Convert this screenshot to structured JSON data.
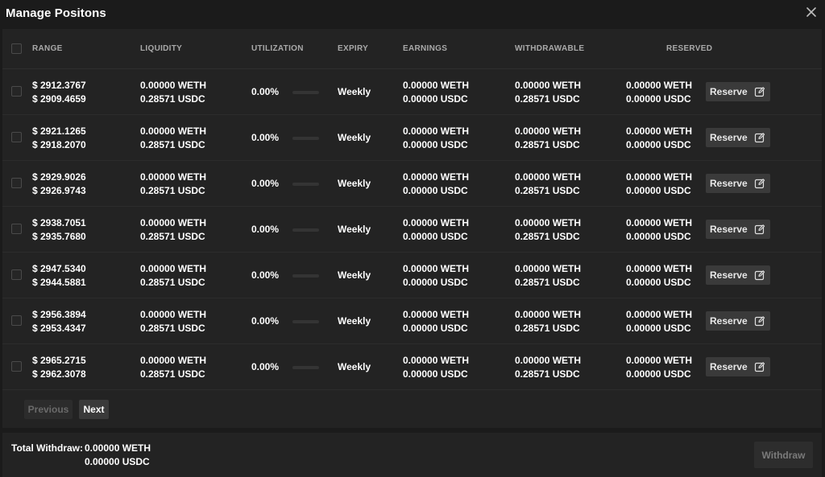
{
  "dialog": {
    "title": "Manage Positons",
    "close_icon": "close-icon"
  },
  "table": {
    "headers": {
      "range": "RANGE",
      "liquidity": "LIQUIDITY",
      "utilization": "UTILIZATION",
      "expiry": "EXPIRY",
      "earnings": "EARNINGS",
      "withdrawable": "WITHDRAWABLE",
      "reserved": "RESERVED"
    },
    "rows": [
      {
        "range_hi": "$ 2912.3767",
        "range_lo": "$ 2909.4659",
        "liq_weth": "0.00000 WETH",
        "liq_usdc": "0.28571 USDC",
        "utilization": "0.00%",
        "utilization_fraction": 0,
        "expiry": "Weekly",
        "earn_weth": "0.00000 WETH",
        "earn_usdc": "0.00000 USDC",
        "wd_weth": "0.00000 WETH",
        "wd_usdc": "0.28571 USDC",
        "res_weth": "0.00000 WETH",
        "res_usdc": "0.00000 USDC",
        "reserve_label": "Reserve"
      },
      {
        "range_hi": "$ 2921.1265",
        "range_lo": "$ 2918.2070",
        "liq_weth": "0.00000 WETH",
        "liq_usdc": "0.28571 USDC",
        "utilization": "0.00%",
        "utilization_fraction": 0,
        "expiry": "Weekly",
        "earn_weth": "0.00000 WETH",
        "earn_usdc": "0.00000 USDC",
        "wd_weth": "0.00000 WETH",
        "wd_usdc": "0.28571 USDC",
        "res_weth": "0.00000 WETH",
        "res_usdc": "0.00000 USDC",
        "reserve_label": "Reserve"
      },
      {
        "range_hi": "$ 2929.9026",
        "range_lo": "$ 2926.9743",
        "liq_weth": "0.00000 WETH",
        "liq_usdc": "0.28571 USDC",
        "utilization": "0.00%",
        "utilization_fraction": 0,
        "expiry": "Weekly",
        "earn_weth": "0.00000 WETH",
        "earn_usdc": "0.00000 USDC",
        "wd_weth": "0.00000 WETH",
        "wd_usdc": "0.28571 USDC",
        "res_weth": "0.00000 WETH",
        "res_usdc": "0.00000 USDC",
        "reserve_label": "Reserve"
      },
      {
        "range_hi": "$ 2938.7051",
        "range_lo": "$ 2935.7680",
        "liq_weth": "0.00000 WETH",
        "liq_usdc": "0.28571 USDC",
        "utilization": "0.00%",
        "utilization_fraction": 0,
        "expiry": "Weekly",
        "earn_weth": "0.00000 WETH",
        "earn_usdc": "0.00000 USDC",
        "wd_weth": "0.00000 WETH",
        "wd_usdc": "0.28571 USDC",
        "res_weth": "0.00000 WETH",
        "res_usdc": "0.00000 USDC",
        "reserve_label": "Reserve"
      },
      {
        "range_hi": "$ 2947.5340",
        "range_lo": "$ 2944.5881",
        "liq_weth": "0.00000 WETH",
        "liq_usdc": "0.28571 USDC",
        "utilization": "0.00%",
        "utilization_fraction": 0,
        "expiry": "Weekly",
        "earn_weth": "0.00000 WETH",
        "earn_usdc": "0.00000 USDC",
        "wd_weth": "0.00000 WETH",
        "wd_usdc": "0.28571 USDC",
        "res_weth": "0.00000 WETH",
        "res_usdc": "0.00000 USDC",
        "reserve_label": "Reserve"
      },
      {
        "range_hi": "$ 2956.3894",
        "range_lo": "$ 2953.4347",
        "liq_weth": "0.00000 WETH",
        "liq_usdc": "0.28571 USDC",
        "utilization": "0.00%",
        "utilization_fraction": 0,
        "expiry": "Weekly",
        "earn_weth": "0.00000 WETH",
        "earn_usdc": "0.00000 USDC",
        "wd_weth": "0.00000 WETH",
        "wd_usdc": "0.28571 USDC",
        "res_weth": "0.00000 WETH",
        "res_usdc": "0.00000 USDC",
        "reserve_label": "Reserve"
      },
      {
        "range_hi": "$ 2965.2715",
        "range_lo": "$ 2962.3078",
        "liq_weth": "0.00000 WETH",
        "liq_usdc": "0.28571 USDC",
        "utilization": "0.00%",
        "utilization_fraction": 0,
        "expiry": "Weekly",
        "earn_weth": "0.00000 WETH",
        "earn_usdc": "0.00000 USDC",
        "wd_weth": "0.00000 WETH",
        "wd_usdc": "0.28571 USDC",
        "res_weth": "0.00000 WETH",
        "res_usdc": "0.00000 USDC",
        "reserve_label": "Reserve"
      }
    ],
    "reserve_icon": "edit-icon"
  },
  "pagination": {
    "previous_label": "Previous",
    "next_label": "Next"
  },
  "footer": {
    "total_label": "Total Withdraw:",
    "total_weth": "0.00000 WETH",
    "total_usdc": "0.00000 USDC",
    "withdraw_label": "Withdraw"
  },
  "colors": {
    "background": "#1b1b1b",
    "panel": "#232323",
    "button": "#3a3a3a",
    "text": "#ffffff",
    "muted": "#a9a9a9"
  }
}
